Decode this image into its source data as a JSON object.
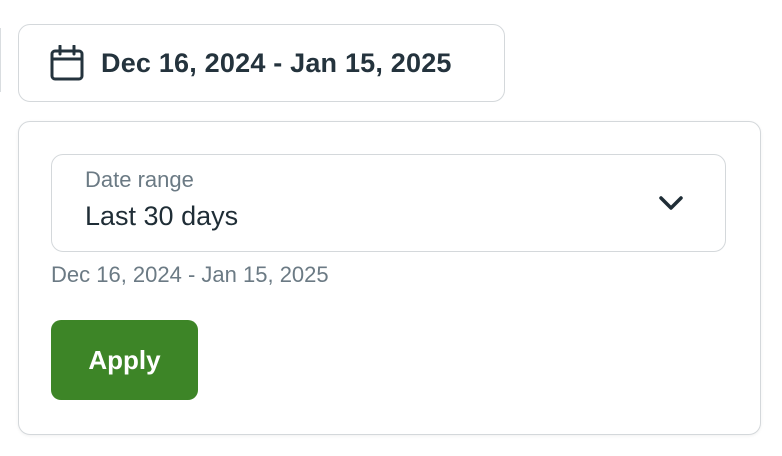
{
  "trigger": {
    "label": "Dec 16, 2024 - Jan 15, 2025",
    "icon": "calendar-icon"
  },
  "popover": {
    "select": {
      "caption": "Date range",
      "value": "Last 30 days",
      "icon": "chevron-down-icon"
    },
    "range_text": "Dec 16, 2024 - Jan 15, 2025",
    "apply_label": "Apply"
  },
  "colors": {
    "text_dark": "#24333d",
    "text_muted": "#6b7a84",
    "border": "#d4d8db",
    "apply_bg": "#3d8527"
  }
}
